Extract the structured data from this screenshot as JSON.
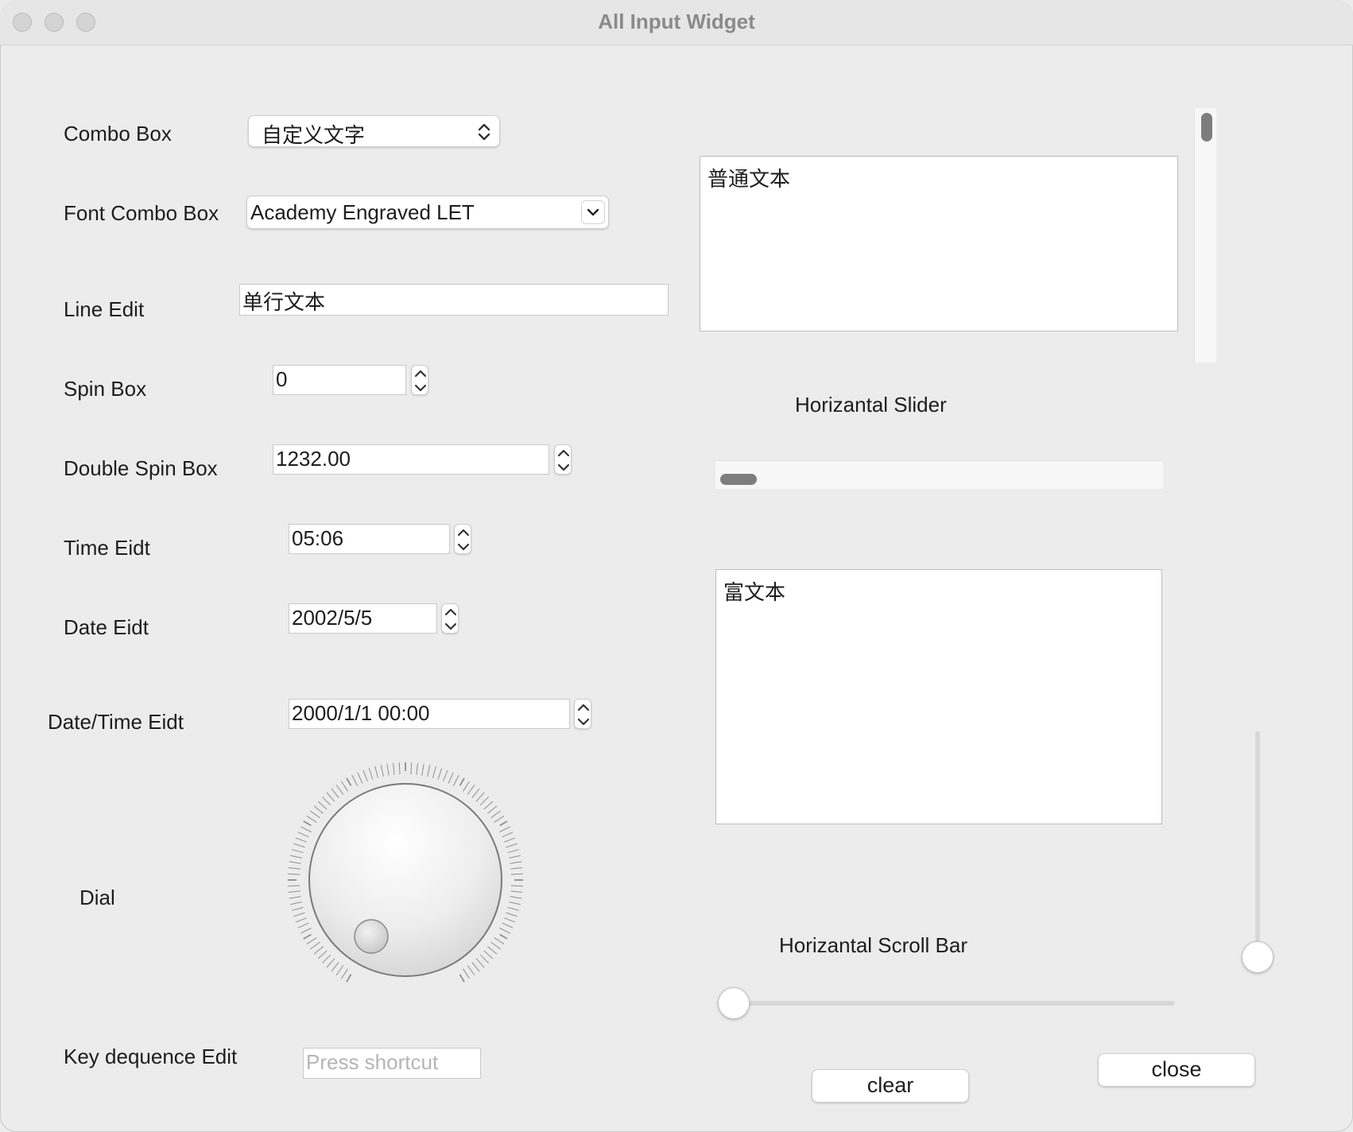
{
  "window": {
    "title": "All Input Widget"
  },
  "labels": {
    "combo_box": "Combo Box",
    "font_combo_box": "Font Combo Box",
    "line_edit": "Line Edit",
    "spin_box": "Spin Box",
    "double_spin_box": "Double Spin Box",
    "time_edit": "Time Eidt",
    "date_edit": "Date Eidt",
    "datetime_edit": "Date/Time Eidt",
    "dial": "Dial",
    "key_sequence_edit": "Key dequence Edit",
    "horizontal_slider": "Horizantal Slider",
    "horizontal_scroll_bar": "Horizantal Scroll Bar"
  },
  "inputs": {
    "combo_box_value": "自定义文字",
    "font_combo_box_value": "Academy Engraved LET",
    "line_edit_value": "单行文本",
    "spin_box_value": "0",
    "double_spin_box_value": "1232.00",
    "time_edit_value": "05:06",
    "date_edit_value": "2002/5/5",
    "datetime_edit_value": "2000/1/1 00:00",
    "key_sequence_placeholder": "Press shortcut"
  },
  "text_areas": {
    "plain_text": "普通文本",
    "rich_text": "富文本"
  },
  "buttons": {
    "clear": "clear",
    "close": "close"
  },
  "values": {
    "horizontal_slider": 0,
    "horizontal_scroll_bar": 0,
    "vertical_slider": 0,
    "vertical_scroll_bar": 0,
    "dial": 0
  },
  "icons": [
    "up-down-chevron-icon",
    "chevron-down-icon",
    "stepper-arrows-icon"
  ]
}
